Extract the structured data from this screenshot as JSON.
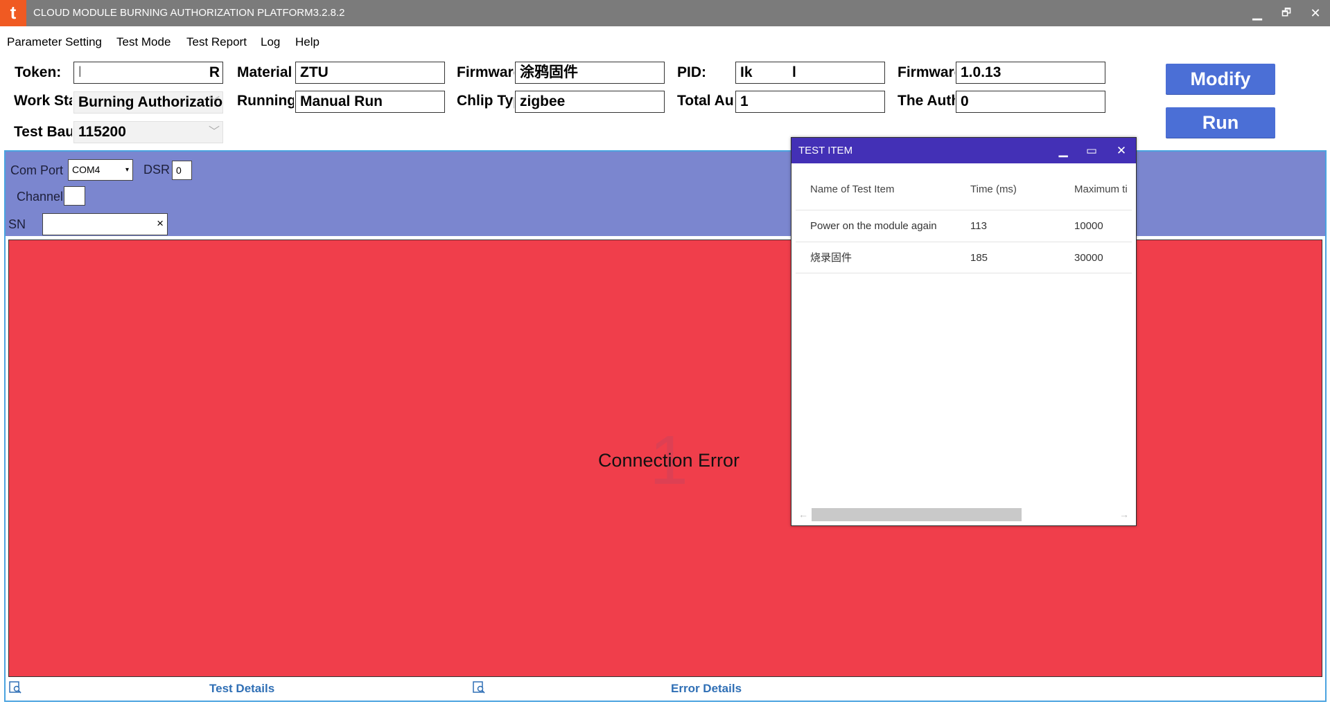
{
  "window": {
    "logo_glyph": "t",
    "title": "CLOUD MODULE BURNING AUTHORIZATION PLATFORM3.2.8.2",
    "minimize_glyph": "▁",
    "restore_glyph": "🗗",
    "close_glyph": "✕"
  },
  "menu": {
    "items": [
      "Parameter Setting",
      "Test Mode",
      "Test Report",
      "Log",
      "Help"
    ]
  },
  "params": {
    "token_label": "Token:",
    "token_value_left": "l",
    "token_value_right": "R",
    "material_label": "Material",
    "material_value": "ZTU",
    "firmware_label": "Firmware",
    "firmware_value": "涂鸦固件",
    "pid_label": "PID:",
    "pid_value": "Ik",
    "pid_value_right": "l",
    "firmware_version_label": "Firmware",
    "firmware_version_value": "1.0.13",
    "work_station_label": "Work Station",
    "work_station_value": "Burning Authorization",
    "running_label": "Running",
    "running_value": "Manual Run",
    "chip_type_label": "Chlip Type",
    "chip_type_value": "zigbee",
    "total_auth_label": "Total Au",
    "total_auth_value": "1",
    "the_auth_label": "The Auth",
    "the_auth_value": "0",
    "test_baud_label": "Test Baud",
    "test_baud_value": "115200",
    "modify_label": "Modify",
    "run_label": "Run"
  },
  "station": {
    "com_port_label": "Com Port",
    "com_port_value": "COM4",
    "dsr_label": "DSR",
    "dsr_value": "0",
    "channel_label": "Channel",
    "channel_value": "",
    "sn_label": "SN",
    "sn_value": "",
    "clear_glyph": "×",
    "big_number": "1",
    "result_text": "Connection Error",
    "result_color": "#f03e4b",
    "test_details_label": "Test Details",
    "error_details_label": "Error Details"
  },
  "test_item_window": {
    "title": "TEST ITEM",
    "minimize_glyph": "▁",
    "maximize_glyph": "▭",
    "close_glyph": "✕",
    "columns": [
      "Name of Test Item",
      "Time (ms)",
      "Maximum ti"
    ],
    "rows": [
      [
        "Power on the module again",
        "113",
        "10000"
      ],
      [
        "烧录固件",
        "185",
        "30000"
      ]
    ],
    "scroll_left_glyph": "←",
    "scroll_right_glyph": "→"
  },
  "colors": {
    "title_bar": "#7b7b7b",
    "logo": "#f05a22",
    "station_header": "#7b86cf",
    "button": "#4b6fd6",
    "test_window_title": "#4330b6",
    "link": "#2f6fb5"
  }
}
